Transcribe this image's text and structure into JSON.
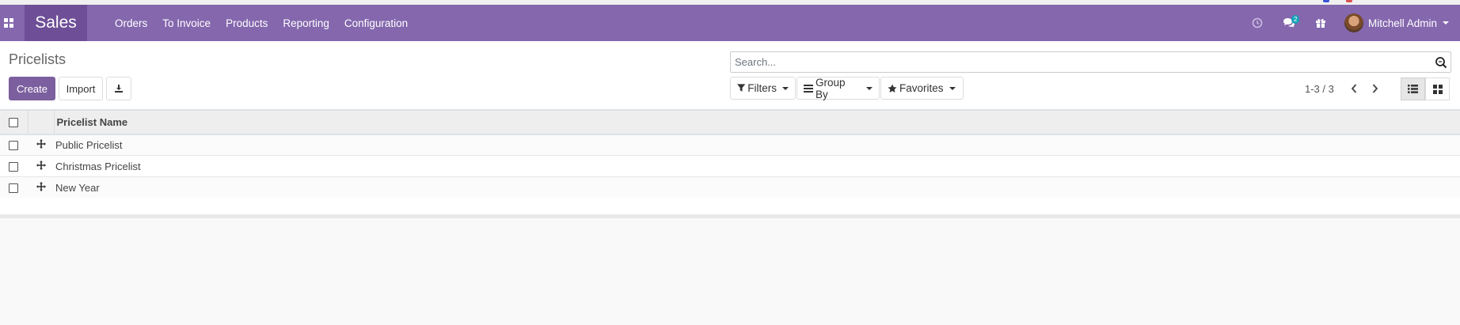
{
  "navbar": {
    "app_name": "Sales",
    "menu": [
      "Orders",
      "To Invoice",
      "Products",
      "Reporting",
      "Configuration"
    ],
    "messages_badge": "2",
    "user_name": "Mitchell Admin",
    "icons": [
      "apps-grid-icon",
      "clock-icon",
      "chat-icon",
      "gift-icon"
    ]
  },
  "control": {
    "title": "Pricelists",
    "create_label": "Create",
    "import_label": "Import",
    "search_placeholder": "Search...",
    "filters_label": "Filters",
    "group_by_label": "Group By",
    "favorites_label": "Favorites",
    "pager": "1-3 / 3"
  },
  "table": {
    "header": "Pricelist Name",
    "rows": [
      "Public Pricelist",
      "Christmas Pricelist",
      "New Year"
    ]
  },
  "colors": {
    "navbar": "#8467ad",
    "brand": "#6e4f97",
    "primary_button": "#7c5f9e",
    "badge": "#17a2b8"
  }
}
